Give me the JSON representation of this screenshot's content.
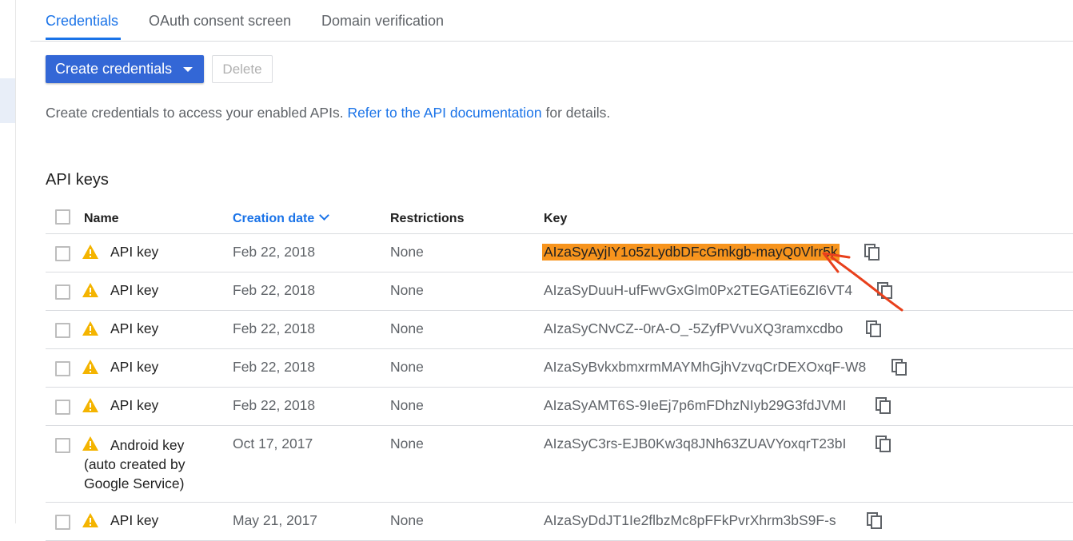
{
  "tabs": [
    {
      "label": "Credentials",
      "active": true
    },
    {
      "label": "OAuth consent screen",
      "active": false
    },
    {
      "label": "Domain verification",
      "active": false
    }
  ],
  "toolbar": {
    "create_label": "Create credentials",
    "delete_label": "Delete"
  },
  "description": {
    "before": "Create credentials to access your enabled APIs. ",
    "link": "Refer to the API documentation",
    "after": " for details."
  },
  "section_title": "API keys",
  "table": {
    "columns": [
      "Name",
      "Creation date",
      "Restrictions",
      "Key"
    ],
    "sorted_column": "Creation date",
    "rows": [
      {
        "name": "API key",
        "date": "Feb 22, 2018",
        "restrictions": "None",
        "key": "AIzaSyAyjIY1o5zLydbDFcGmkgb-mayQ0Vlrr5k",
        "highlighted": true
      },
      {
        "name": "API key",
        "date": "Feb 22, 2018",
        "restrictions": "None",
        "key": "AIzaSyDuuH-ufFwvGxGlm0Px2TEGATiE6ZI6VT4"
      },
      {
        "name": "API key",
        "date": "Feb 22, 2018",
        "restrictions": "None",
        "key": "AIzaSyCNvCZ--0rA-O_-5ZyfPVvuXQ3ramxcdbo"
      },
      {
        "name": "API key",
        "date": "Feb 22, 2018",
        "restrictions": "None",
        "key": "AIzaSyBvkxbmxrmMAYMhGjhVzvqCrDEXOxqF-W8"
      },
      {
        "name": "API key",
        "date": "Feb 22, 2018",
        "restrictions": "None",
        "key": "AIzaSyAMT6S-9IeEj7p6mFDhzNIyb29G3fdJVMI"
      },
      {
        "name": "Android key (auto created by Google Service)",
        "date": "Oct 17, 2017",
        "restrictions": "None",
        "key": "AIzaSyC3rs-EJB0Kw3q8JNh63ZUAVYoxqrT23bI"
      },
      {
        "name": "API key",
        "date": "May 21, 2017",
        "restrictions": "None",
        "key": "AIzaSyDdJT1Ie2flbzMc8pFFkPvrXhrm3bS9F-s"
      }
    ]
  },
  "colors": {
    "accent": "#1a73e8",
    "primary_button": "#3367d6",
    "warning": "#f4b400",
    "highlight": "#f7941d",
    "annotation": "#e8401c"
  },
  "icons": {
    "row_status": "warning-icon",
    "copy": "copy-icon",
    "sort": "chevron-down-icon"
  }
}
